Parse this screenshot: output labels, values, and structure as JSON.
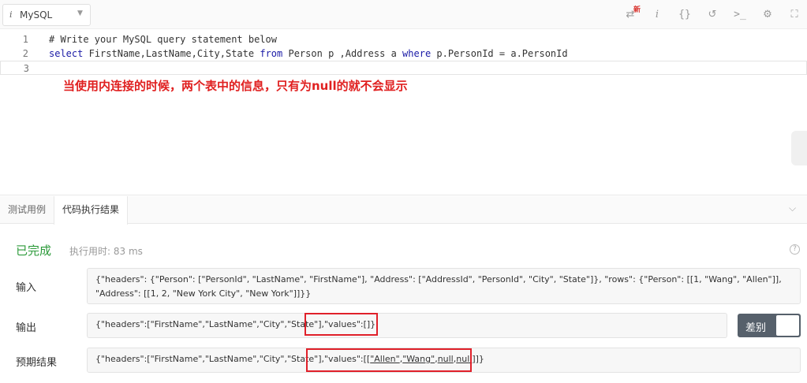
{
  "toolbar": {
    "language": "MySQL",
    "info_glyph": "i",
    "new_badge": "新",
    "icons": [
      "shuffle-icon",
      "info-icon",
      "braces-icon",
      "undo-icon",
      "terminal-icon",
      "gear-icon",
      "fullscreen-icon"
    ]
  },
  "editor": {
    "lines": [
      {
        "num": "1",
        "text": "# Write your MySQL query statement below"
      },
      {
        "num": "2",
        "text": "select FirstName,LastName,City,State from Person p ,Address a where p.PersonId = a.PersonId"
      },
      {
        "num": "3",
        "text": ""
      }
    ],
    "note": "当使用内连接的时候，两个表中的信息，只有为null的就不会显示"
  },
  "tabs": [
    {
      "label": "测试用例"
    },
    {
      "label": "代码执行结果"
    }
  ],
  "result": {
    "status": "已完成",
    "runtime": "执行用时: 83 ms",
    "help": "?",
    "input_label": "输入",
    "input_value": "{\"headers\": {\"Person\": [\"PersonId\", \"LastName\", \"FirstName\"], \"Address\": [\"AddressId\", \"PersonId\", \"City\", \"State\"]}, \"rows\": {\"Person\": [[1, \"Wang\", \"Allen\"]], \"Address\": [[1, 2, \"New York City\", \"New York\"]]}}",
    "output_label": "输出",
    "output_value": "{\"headers\":[\"FirstName\",\"LastName\",\"City\",\"State\"],\"values\":[]}",
    "expected_label": "预期结果",
    "expected_prefix": "{\"headers\":[\"FirstName\",\"LastName\",\"City\",\"State\"],\"values\":[[",
    "expected_u1": "\"Allen\"",
    "expected_c1": ",",
    "expected_u2": "\"Wang\"",
    "expected_c2": ",",
    "expected_u3": "null",
    "expected_c3": ",",
    "expected_u4": "null",
    "expected_suffix": "]]}",
    "diff_label": "差别"
  },
  "colors": {
    "success": "#2c9a3a",
    "annotation": "#e0202a",
    "keyword": "#1a1aa6",
    "comment": "#318a31"
  }
}
